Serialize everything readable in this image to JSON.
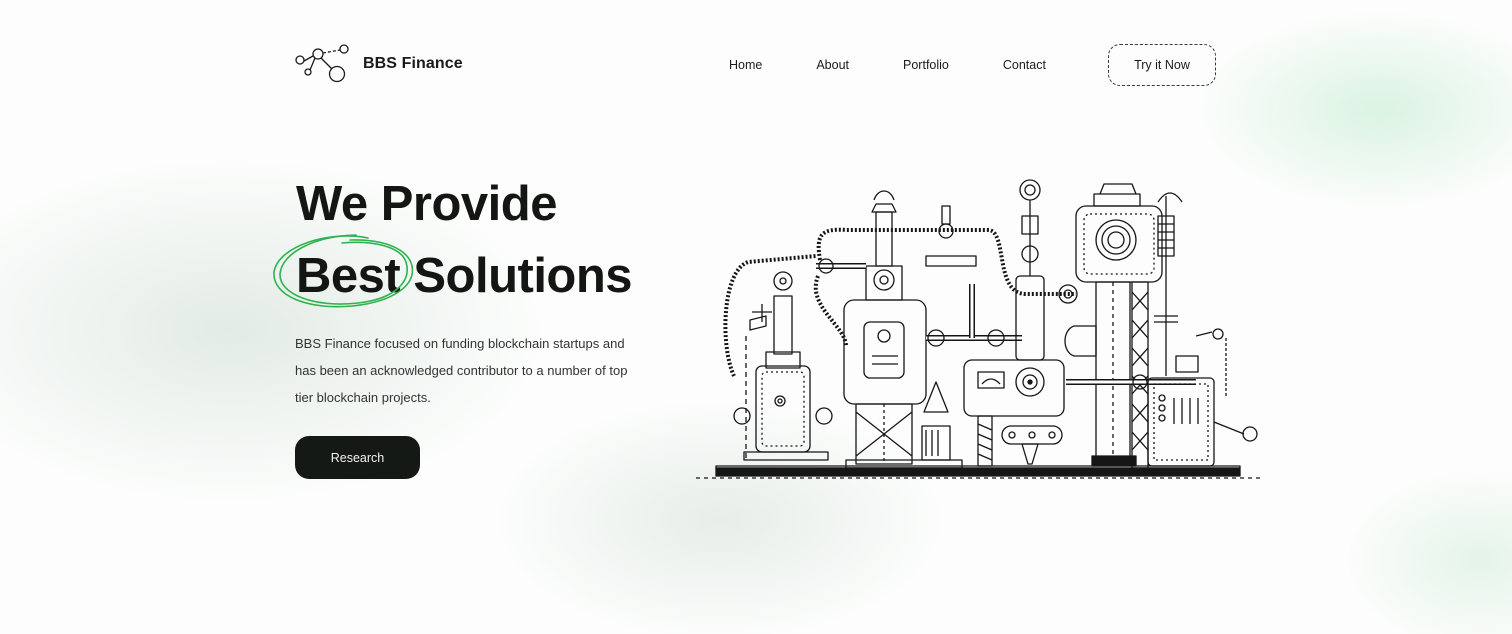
{
  "header": {
    "brand": "BBS Finance",
    "logo_icon": "molecule-icon",
    "nav": [
      {
        "label": "Home"
      },
      {
        "label": "About"
      },
      {
        "label": "Portfolio"
      },
      {
        "label": "Contact"
      }
    ],
    "cta_label": "Try it Now"
  },
  "hero": {
    "title_line1": "We Provide",
    "title_highlight": "Best",
    "title_rest": "Solutions",
    "description": "BBS Finance focused on funding blockchain startups and has been an acknowledged contributor to a number of top tier blockchain projects.",
    "button_label": "Research",
    "illustration": "industrial-machine-illustration"
  },
  "colors": {
    "accent_green": "#2fb34e",
    "dark": "#151915",
    "background": "#fcfdfc"
  }
}
